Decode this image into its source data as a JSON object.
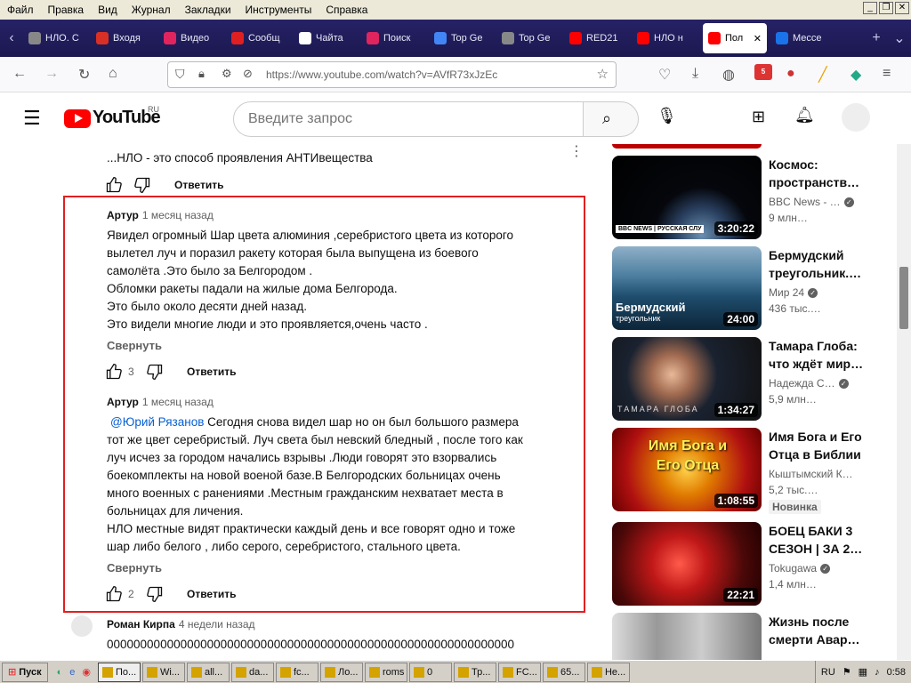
{
  "menubar": {
    "items": [
      "Файл",
      "Правка",
      "Вид",
      "Журнал",
      "Закладки",
      "Инструменты",
      "Справка"
    ]
  },
  "tabs": [
    {
      "label": "НЛО. С",
      "icon": "page-icon",
      "color": "#888888"
    },
    {
      "label": "Входя",
      "icon": "gmail-icon",
      "color": "#d93025"
    },
    {
      "label": "Видео",
      "icon": "video-icon",
      "color": "#e0245e"
    },
    {
      "label": "Сообщ",
      "icon": "alert-icon",
      "color": "#e02020"
    },
    {
      "label": "Чайта",
      "icon": "wikipedia-icon",
      "color": "#ffffff"
    },
    {
      "label": "Поиск",
      "icon": "video-icon",
      "color": "#e0245e"
    },
    {
      "label": "Top Ge",
      "icon": "google-icon",
      "color": "#4285f4"
    },
    {
      "label": "Top Ge",
      "icon": "plane-icon",
      "color": "#888888"
    },
    {
      "label": "RED21",
      "icon": "youtube-icon",
      "color": "#ff0000"
    },
    {
      "label": "НЛО н",
      "icon": "youtube-icon",
      "color": "#ff0000"
    },
    {
      "label": "Пол",
      "icon": "youtube-icon",
      "color": "#ff0000",
      "active": true
    },
    {
      "label": "Мессе",
      "icon": "chat-icon",
      "color": "#1a73e8"
    }
  ],
  "nav": {
    "url": "https://www.youtube.com/watch?v=AVfR73xJzEc",
    "addon_badge": "5"
  },
  "youtube": {
    "logo": "YouTube",
    "region": "RU",
    "search_placeholder": "Введите запрос"
  },
  "comments": {
    "top_text": "...НЛО - это способ проявления АНТИвещества",
    "top_reply": "Ответить",
    "c1": {
      "author": "Артур",
      "time": "1 месяц назад",
      "lines": [
        "Явидел огромный Шар цвета алюминия ,серебристого цвета из которого",
        "вылетел луч и поразил ракету которая была выпущена из боевого",
        "самолёта .Это было за  Белгородом  .",
        "Обломки ракеты падали на жилые дома Белгорода.",
        "Это было около десяти дней назад.",
        "Это видели многие люди и это проявляется,очень часто ."
      ],
      "collapse": "Свернуть",
      "likes": "3",
      "reply": "Ответить"
    },
    "c2": {
      "author": "Артур",
      "time": "1 месяц назад",
      "mention": "@Юрий Рязанов",
      "first_line": "  Сегодня снова видел шар но он был большого размера",
      "lines": [
        "тот же цвет серебристый. Луч света был невский бледный , после того как",
        "луч исчез за городом начались взрывы .Люди говорят это взорвались",
        "боекомплекты на новой военой базе.В Белгородских больницах очень",
        "много военных с ранениями .Местным гражданским  нехватает места в",
        "больницах  для личения.",
        "НЛО местные видят практически каждый день и все говорят одно и тоже",
        "шар либо белого , либо серого, серебристого, стального цвета."
      ],
      "collapse": "Свернуть",
      "likes": "2",
      "reply": "Ответить"
    },
    "c3": {
      "author": "Роман Кирпа",
      "time": "4 недели назад",
      "text": "0000000000000000000000000000000000000000000000000000000000000"
    }
  },
  "sidebar": [
    {
      "title1": "Космос:",
      "title2": "пространств…",
      "channel": "BBC News - …",
      "meta": "9 млн…",
      "duration": "3:20:22",
      "thumb_text": "BBC NEWS | РУССКАЯ СЛУ"
    },
    {
      "title1": "Бермудский",
      "title2": "треугольник.…",
      "channel": "Мир 24",
      "meta": "436 тыс.…",
      "duration": "24:00",
      "thumb_text": "Бермудский",
      "thumb_text2": "треугольник"
    },
    {
      "title1": "Тамара Глоба:",
      "title2": "что ждёт мир…",
      "channel": "Надежда С…",
      "meta": "5,9 млн…",
      "duration": "1:34:27",
      "thumb_text": "ТАМАРА ГЛОБА"
    },
    {
      "title1": "Имя Бога и Его",
      "title2": "Отца в Библии",
      "channel": "Кыштымский К…",
      "meta": "5,2 тыс.…",
      "duration": "1:08:55",
      "badge": "Новинка",
      "thumb_text": "Имя Бога и Его Отца"
    },
    {
      "title1": "БОЕЦ БАКИ 3",
      "title2": "СЕЗОН | ЗА 2…",
      "channel": "Tokugawa",
      "meta": "1,4 млн…",
      "duration": "22:21"
    },
    {
      "title1": "Жизнь после",
      "title2": "смерти Авар…",
      "channel": "",
      "meta": "",
      "duration": ""
    }
  ],
  "taskbar": {
    "start": "Пуск",
    "items": [
      "По...",
      "Wi...",
      "all...",
      "da...",
      "fc...",
      "Ло...",
      "roms",
      "0",
      "Тр...",
      "FC...",
      "65...",
      "Не..."
    ],
    "lang": "RU",
    "time": "0:58"
  },
  "colors": {
    "highlight": "#e02020",
    "yt_red": "#ff0000",
    "link": "#065fd4"
  }
}
